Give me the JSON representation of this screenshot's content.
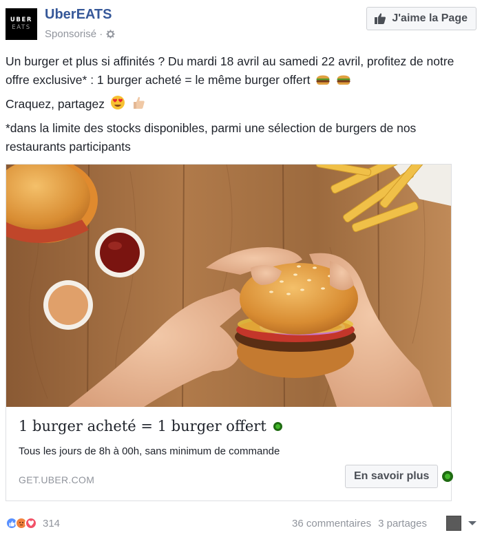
{
  "header": {
    "logo_line1": "UBER",
    "logo_line2": "EATS",
    "page_name": "UberEATS",
    "sponsored_label": "Sponsorisé ·",
    "like_page_label": "J'aime la Page"
  },
  "post": {
    "line1": "Un burger et plus si affinités ? Du mardi 18 avril au samedi 22 avril, profitez de notre offre exclusive* : 1 burger acheté = le même burger offert",
    "line2": "Craquez, partagez",
    "line3": "*dans la limite des stocks disponibles, parmi une sélection de burgers de nos restaurants participants"
  },
  "card": {
    "title": "1 burger acheté = 1 burger offert",
    "description": "Tous les jours de 8h à 00h, sans minimum de commande",
    "domain": "GET.UBER.COM",
    "cta_label": "En savoir plus"
  },
  "footer": {
    "reaction_count": "314",
    "comments": "36 commentaires",
    "shares": "3 partages"
  },
  "colors": {
    "facebook_blue": "#365899",
    "meta_gray": "#90949c",
    "border": "#dddfe2",
    "ad_badge_green": "#42b72a"
  },
  "icons": [
    "globe-gear-icon",
    "thumbs-up-icon",
    "burger-emoji",
    "heart-eyes-emoji",
    "thumbs-up-emoji",
    "green-dot-icon",
    "like-reaction-icon",
    "angry-reaction-icon",
    "love-reaction-icon",
    "caret-down-icon"
  ]
}
